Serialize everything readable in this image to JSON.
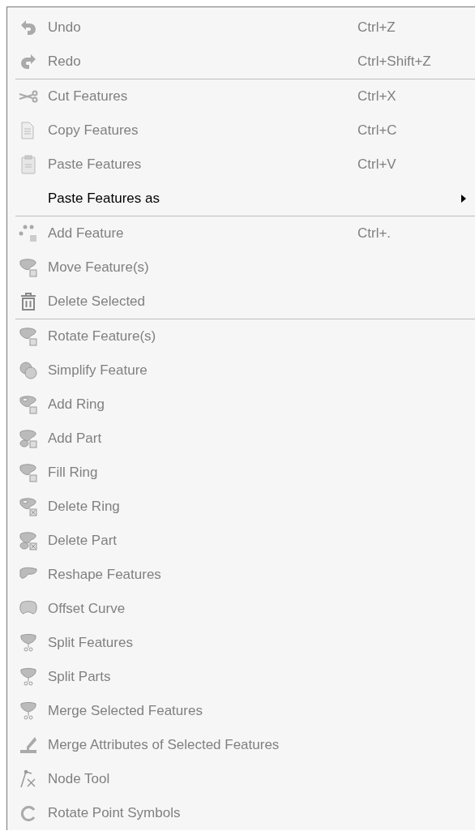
{
  "context_menu": {
    "sections": [
      [
        {
          "label": "Undo",
          "shortcut": "Ctrl+Z",
          "disabled": true,
          "submenu": false
        },
        {
          "label": "Redo",
          "shortcut": "Ctrl+Shift+Z",
          "disabled": true,
          "submenu": false
        }
      ],
      [
        {
          "label": "Cut Features",
          "shortcut": "Ctrl+X",
          "disabled": true,
          "submenu": false
        },
        {
          "label": "Copy Features",
          "shortcut": "Ctrl+C",
          "disabled": true,
          "submenu": false
        },
        {
          "label": "Paste Features",
          "shortcut": "Ctrl+V",
          "disabled": true,
          "submenu": false
        },
        {
          "label": "Paste Features as",
          "disabled": false,
          "submenu": true
        }
      ],
      [
        {
          "label": "Add Feature",
          "shortcut": "Ctrl+.",
          "disabled": true,
          "submenu": false
        },
        {
          "label": "Move Feature(s)",
          "disabled": true,
          "submenu": false
        },
        {
          "label": "Delete Selected",
          "disabled": true,
          "submenu": false
        }
      ],
      [
        {
          "label": "Rotate Feature(s)",
          "disabled": true,
          "submenu": false
        },
        {
          "label": "Simplify Feature",
          "disabled": true,
          "submenu": false
        },
        {
          "label": "Add Ring",
          "disabled": true,
          "submenu": false
        },
        {
          "label": "Add Part",
          "disabled": true,
          "submenu": false
        },
        {
          "label": "Fill Ring",
          "disabled": true,
          "submenu": false
        },
        {
          "label": "Delete Ring",
          "disabled": true,
          "submenu": false
        },
        {
          "label": "Delete Part",
          "disabled": true,
          "submenu": false
        },
        {
          "label": "Reshape Features",
          "disabled": true,
          "submenu": false
        },
        {
          "label": "Offset Curve",
          "disabled": true,
          "submenu": false
        },
        {
          "label": "Split Features",
          "disabled": true,
          "submenu": false
        },
        {
          "label": "Split Parts",
          "disabled": true,
          "submenu": false
        },
        {
          "label": "Merge Selected Features",
          "disabled": true,
          "submenu": false
        },
        {
          "label": "Merge Attributes of Selected Features",
          "disabled": true,
          "submenu": false
        },
        {
          "label": "Node Tool",
          "disabled": true,
          "submenu": false
        },
        {
          "label": "Rotate Point Symbols",
          "disabled": true,
          "submenu": false
        }
      ]
    ]
  }
}
